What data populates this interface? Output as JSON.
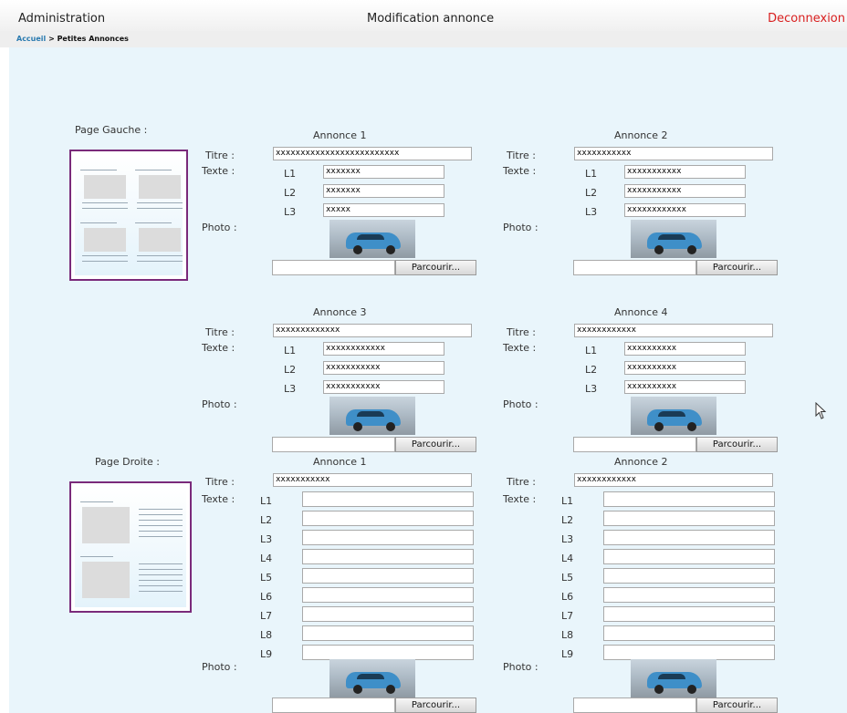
{
  "header": {
    "left": "Administration",
    "title": "Modification annonce",
    "logout": "Deconnexion"
  },
  "breadcrumb": {
    "home": "Accueil",
    "sep": " > ",
    "current": "Petites Annonces"
  },
  "labels": {
    "titre": "Titre :",
    "texte": "Texte :",
    "photo": "Photo :",
    "browse": "Parcourir..."
  },
  "page_gauche": {
    "label": "Page Gauche :",
    "ads": [
      {
        "heading": "Annonce 1",
        "title": "xxxxxxxxxxxxxxxxxxxxxxxxx",
        "lines": [
          {
            "label": "L1",
            "value": "xxxxxxx"
          },
          {
            "label": "L2",
            "value": "xxxxxxx"
          },
          {
            "label": "L3",
            "value": "xxxxx"
          }
        ]
      },
      {
        "heading": "Annonce 2",
        "title": "xxxxxxxxxxx",
        "lines": [
          {
            "label": "L1",
            "value": "xxxxxxxxxxx"
          },
          {
            "label": "L2",
            "value": "xxxxxxxxxxx"
          },
          {
            "label": "L3",
            "value": "xxxxxxxxxxxx"
          }
        ]
      },
      {
        "heading": "Annonce 3",
        "title": "xxxxxxxxxxxxx",
        "lines": [
          {
            "label": "L1",
            "value": "xxxxxxxxxxxx"
          },
          {
            "label": "L2",
            "value": "xxxxxxxxxxx"
          },
          {
            "label": "L3",
            "value": "xxxxxxxxxxx"
          }
        ]
      },
      {
        "heading": "Annonce 4",
        "title": "xxxxxxxxxxxx",
        "lines": [
          {
            "label": "L1",
            "value": "xxxxxxxxxx"
          },
          {
            "label": "L2",
            "value": "xxxxxxxxxx"
          },
          {
            "label": "L3",
            "value": "xxxxxxxxxx"
          }
        ]
      }
    ]
  },
  "page_droite": {
    "label": "Page Droite :",
    "ads": [
      {
        "heading": "Annonce 1",
        "title": "xxxxxxxxxxx",
        "lines": [
          "L1",
          "L2",
          "L3",
          "L4",
          "L5",
          "L6",
          "L7",
          "L8",
          "L9"
        ]
      },
      {
        "heading": "Annonce 2",
        "title": "xxxxxxxxxxxx",
        "lines": [
          "L1",
          "L2",
          "L3",
          "L4",
          "L5",
          "L6",
          "L7",
          "L8",
          "L9"
        ]
      }
    ]
  }
}
